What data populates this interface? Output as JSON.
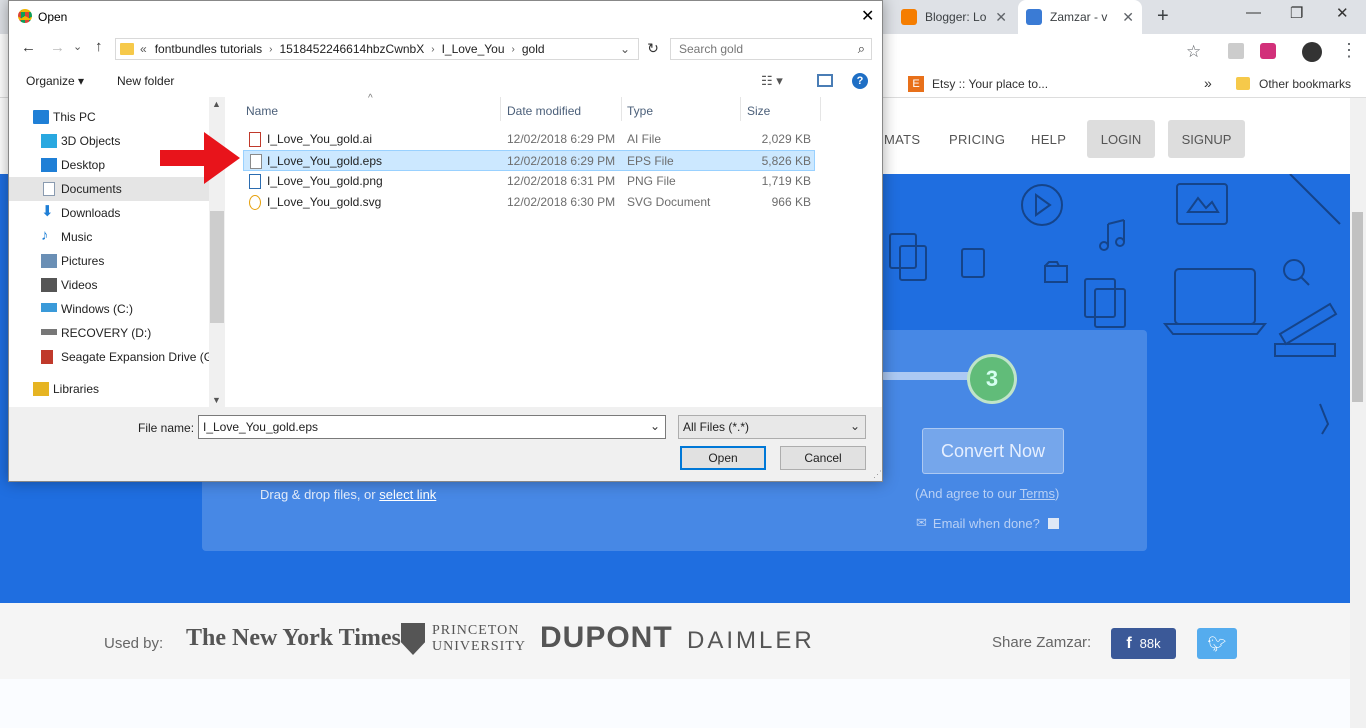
{
  "browser": {
    "tabs": [
      {
        "title": "Blogger: Lo",
        "favicon_color": "#f57d00"
      },
      {
        "title": "Zamzar - v",
        "favicon_color": "#3a7bd5"
      }
    ],
    "new_tab_label": "+",
    "bookmarks": [
      {
        "label": "Etsy :: Your place to..."
      },
      {
        "label": "Other bookmarks"
      }
    ],
    "bookmarks_more": "»"
  },
  "site": {
    "nav": {
      "formats_partial": "MATS",
      "pricing": "PRICING",
      "help": "HELP",
      "login": "LOGIN",
      "signup": "SIGNUP"
    },
    "step_number": "3",
    "convert_button": "Convert Now",
    "agree_prefix": "(And agree to our ",
    "terms_link": "Terms",
    "agree_suffix": ")",
    "email_label": "Email when done?",
    "drag_drop_text": "Drag & drop files, or ",
    "select_link": "select link",
    "used_by_label": "Used by:",
    "logos": [
      "The New York Times",
      "PRINCETON",
      "UNIVERSITY",
      "DUPONT",
      "DAIMLER"
    ],
    "share_label": "Share Zamzar:",
    "facebook_count": "88k"
  },
  "dialog": {
    "title": "Open",
    "breadcrumb": [
      "«",
      "fontbundles tutorials",
      "1518452246614hbzCwnbX",
      "I_Love_You",
      "gold"
    ],
    "search_placeholder": "Search gold",
    "organize_label": "Organize ▾",
    "new_folder_label": "New folder",
    "nav_items": [
      {
        "label": "This PC",
        "icon": "pc-icon",
        "color": "#1f7fd6"
      },
      {
        "label": "3D Objects",
        "icon": "cube-icon",
        "color": "#29a8e0"
      },
      {
        "label": "Desktop",
        "icon": "desktop-icon",
        "color": "#1f7fd6"
      },
      {
        "label": "Documents",
        "icon": "documents-icon",
        "color": "#8a9bb0"
      },
      {
        "label": "Downloads",
        "icon": "download-icon",
        "color": "#1f7fd6"
      },
      {
        "label": "Music",
        "icon": "music-icon",
        "color": "#1f7fd6"
      },
      {
        "label": "Pictures",
        "icon": "pictures-icon",
        "color": "#6a8fb5"
      },
      {
        "label": "Videos",
        "icon": "videos-icon",
        "color": "#555"
      },
      {
        "label": "Windows (C:)",
        "icon": "drive-icon",
        "color": "#3a9ad9"
      },
      {
        "label": "RECOVERY (D:)",
        "icon": "drive-icon",
        "color": "#777"
      },
      {
        "label": "Seagate Expansion Drive (G:",
        "icon": "usb-drive-icon",
        "color": "#c0392b"
      },
      {
        "label": "Libraries",
        "icon": "libraries-icon",
        "color": "#e6b422"
      }
    ],
    "columns": {
      "name": "Name",
      "date": "Date modified",
      "type": "Type",
      "size": "Size"
    },
    "files": [
      {
        "name": "I_Love_You_gold.ai",
        "date": "12/02/2018 6:29 PM",
        "type": "AI File",
        "size": "2,029 KB",
        "icon": "ai-file-icon"
      },
      {
        "name": "I_Love_You_gold.eps",
        "date": "12/02/2018 6:29 PM",
        "type": "EPS File",
        "size": "5,826 KB",
        "icon": "eps-file-icon"
      },
      {
        "name": "I_Love_You_gold.png",
        "date": "12/02/2018 6:31 PM",
        "type": "PNG File",
        "size": "1,719 KB",
        "icon": "png-file-icon"
      },
      {
        "name": "I_Love_You_gold.svg",
        "date": "12/02/2018 6:30 PM",
        "type": "SVG Document",
        "size": "966 KB",
        "icon": "svg-file-icon"
      }
    ],
    "selected_index": 1,
    "file_name_label": "File name:",
    "file_name_value": "I_Love_You_gold.eps",
    "file_type_value": "All Files (*.*)",
    "open_button": "Open",
    "cancel_button": "Cancel"
  }
}
